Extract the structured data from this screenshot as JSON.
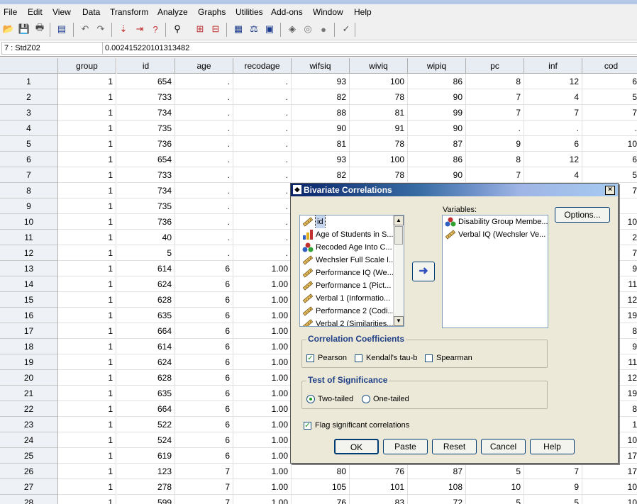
{
  "menu": [
    "File",
    "Edit",
    "View",
    "Data",
    "Transform",
    "Analyze",
    "Graphs",
    "Utilities",
    "Add-ons",
    "Window",
    "Help"
  ],
  "toolbar_icons": [
    "open-icon",
    "save-icon",
    "print-icon",
    "dialog-recall-icon",
    "undo-icon",
    "redo-icon",
    "goto-case-icon",
    "goto-variable-icon",
    "variables-icon",
    "find-icon",
    "insert-cases-icon",
    "insert-variable-icon",
    "split-file-icon",
    "weight-cases-icon",
    "select-cases-icon",
    "value-labels-icon",
    "use-sets-icon",
    "show-all-variables-icon",
    "spell-check-icon"
  ],
  "cellbar": {
    "ref": "7 : StdZ02",
    "value": "0.002415220101313482"
  },
  "grid": {
    "columns": [
      "group",
      "id",
      "age",
      "recodage",
      "wifsiq",
      "wiviq",
      "wipiq",
      "pc",
      "inf",
      "cod"
    ],
    "rows": [
      [
        "1",
        "1",
        "654",
        ".",
        ".",
        "93",
        "100",
        "86",
        "8",
        "12",
        "6"
      ],
      [
        "2",
        "1",
        "733",
        ".",
        ".",
        "82",
        "78",
        "90",
        "7",
        "4",
        "5"
      ],
      [
        "3",
        "1",
        "734",
        ".",
        ".",
        "88",
        "81",
        "99",
        "7",
        "7",
        "7"
      ],
      [
        "4",
        "1",
        "735",
        ".",
        ".",
        "90",
        "91",
        "90",
        ".",
        ".",
        "."
      ],
      [
        "5",
        "1",
        "736",
        ".",
        ".",
        "81",
        "78",
        "87",
        "9",
        "6",
        "10"
      ],
      [
        "6",
        "1",
        "654",
        ".",
        ".",
        "93",
        "100",
        "86",
        "8",
        "12",
        "6"
      ],
      [
        "7",
        "1",
        "733",
        ".",
        ".",
        "82",
        "78",
        "90",
        "7",
        "4",
        "5"
      ],
      [
        "8",
        "1",
        "734",
        ".",
        ".",
        "",
        "",
        "",
        "",
        "",
        "7"
      ],
      [
        "9",
        "1",
        "735",
        ".",
        ".",
        "",
        "",
        "",
        "",
        "",
        ""
      ],
      [
        "10",
        "1",
        "736",
        ".",
        ".",
        "",
        "",
        "",
        "",
        "",
        "10"
      ],
      [
        "11",
        "1",
        "40",
        ".",
        ".",
        "",
        "",
        "",
        "",
        "",
        "2"
      ],
      [
        "12",
        "1",
        "5",
        ".",
        ".",
        "",
        "",
        "",
        "",
        "",
        "7"
      ],
      [
        "13",
        "1",
        "614",
        "6",
        "1.00",
        "",
        "",
        "",
        "",
        "",
        "9"
      ],
      [
        "14",
        "1",
        "624",
        "6",
        "1.00",
        "",
        "",
        "",
        "",
        "",
        "11"
      ],
      [
        "15",
        "1",
        "628",
        "6",
        "1.00",
        "",
        "",
        "",
        "",
        "",
        "12"
      ],
      [
        "16",
        "1",
        "635",
        "6",
        "1.00",
        "",
        "",
        "",
        "",
        "",
        "19"
      ],
      [
        "17",
        "1",
        "664",
        "6",
        "1.00",
        "",
        "",
        "",
        "",
        "",
        "8"
      ],
      [
        "18",
        "1",
        "614",
        "6",
        "1.00",
        "",
        "",
        "",
        "",
        "",
        "9"
      ],
      [
        "19",
        "1",
        "624",
        "6",
        "1.00",
        "",
        "",
        "",
        "",
        "",
        "11"
      ],
      [
        "20",
        "1",
        "628",
        "6",
        "1.00",
        "",
        "",
        "",
        "",
        "",
        "12"
      ],
      [
        "21",
        "1",
        "635",
        "6",
        "1.00",
        "",
        "",
        "",
        "",
        "",
        "19"
      ],
      [
        "22",
        "1",
        "664",
        "6",
        "1.00",
        "",
        "",
        "",
        "",
        "",
        "8"
      ],
      [
        "23",
        "1",
        "522",
        "6",
        "1.00",
        "",
        "",
        "",
        "",
        "",
        "1"
      ],
      [
        "24",
        "1",
        "524",
        "6",
        "1.00",
        "",
        "",
        "",
        "",
        "",
        "10"
      ],
      [
        "25",
        "1",
        "619",
        "6",
        "1.00",
        "",
        "",
        "",
        "",
        "",
        "17"
      ],
      [
        "26",
        "1",
        "123",
        "7",
        "1.00",
        "80",
        "76",
        "87",
        "5",
        "7",
        "17"
      ],
      [
        "27",
        "1",
        "278",
        "7",
        "1.00",
        "105",
        "101",
        "108",
        "10",
        "9",
        "10"
      ],
      [
        "28",
        "1",
        "599",
        "7",
        "1.00",
        "76",
        "83",
        "72",
        "5",
        "5",
        "10"
      ]
    ]
  },
  "dialog": {
    "title": "Bivariate Correlations",
    "source_items": [
      {
        "label": "id",
        "icon": "scale-icon",
        "selected": true
      },
      {
        "label": "Age of Students in S...",
        "icon": "ordinal-icon"
      },
      {
        "label": "Recoded Age Into C...",
        "icon": "nominal-icon"
      },
      {
        "label": "Wechsler Full Scale I...",
        "icon": "scale-icon"
      },
      {
        "label": "Performance IQ (We...",
        "icon": "scale-icon"
      },
      {
        "label": "Performance 1 (Pict...",
        "icon": "scale-icon"
      },
      {
        "label": "Verbal 1 (Informatio...",
        "icon": "scale-icon"
      },
      {
        "label": "Performance 2 (Codi...",
        "icon": "scale-icon"
      },
      {
        "label": "Verbal 2 (Similarities...",
        "icon": "scale-icon"
      }
    ],
    "variables_label": "Variables:",
    "target_items": [
      {
        "label": "Disability Group Membe...",
        "icon": "nominal-icon"
      },
      {
        "label": "Verbal IQ (Wechsler Ve...",
        "icon": "scale-icon"
      }
    ],
    "options_label": "Options...",
    "coefficients": {
      "title": "Correlation Coefficients",
      "pearson": "Pearson",
      "pearson_checked": true,
      "kendall": "Kendall's tau-b",
      "kendall_checked": false,
      "spearman": "Spearman",
      "spearman_checked": false
    },
    "significance": {
      "title": "Test of Significance",
      "two_tailed": "Two-tailed",
      "one_tailed": "One-tailed",
      "selected": "two_tailed"
    },
    "flag": {
      "label": "Flag significant correlations",
      "checked": true
    },
    "buttons": [
      "OK",
      "Paste",
      "Reset",
      "Cancel",
      "Help"
    ]
  }
}
